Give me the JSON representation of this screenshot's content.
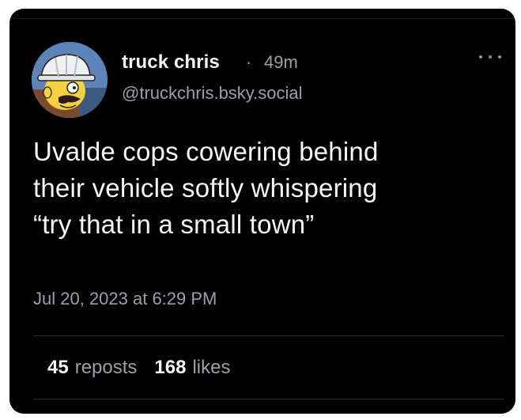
{
  "post": {
    "author": {
      "display_name": "truck chris",
      "handle": "@truckchris.bsky.social",
      "avatar_icon": "hardhat-cartoon-avatar"
    },
    "separator": "·",
    "time_ago": "49m",
    "text": "Uvalde cops cowering behind\ntheir vehicle softly whispering\n“try that in a small town”",
    "timestamp": "Jul 20, 2023 at 6:29 PM",
    "stats": {
      "reposts_count": "45",
      "reposts_label": "reposts",
      "likes_count": "168",
      "likes_label": "likes"
    },
    "more_icon": "more-horizontal-icon"
  },
  "colors": {
    "background": "#000000",
    "primary_text": "#f5f5f5",
    "secondary_text": "#9aa0a6",
    "divider": "#2b2b2e"
  }
}
